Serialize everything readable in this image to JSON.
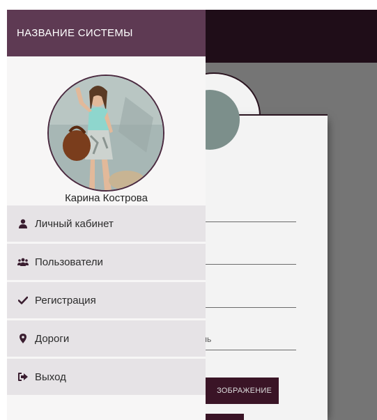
{
  "sidebar": {
    "system_title": "НАЗВАНИЕ СИСТЕМЫ",
    "user_name": "Карина Кострова",
    "items": [
      {
        "label": "Личный кабинет",
        "icon": "user-icon"
      },
      {
        "label": "Пользователи",
        "icon": "users-icon"
      },
      {
        "label": "Регистрация",
        "icon": "check-icon"
      },
      {
        "label": "Дороги",
        "icon": "map-marker-icon"
      },
      {
        "label": "Выход",
        "icon": "sign-out-icon"
      }
    ]
  },
  "background": {
    "upload_button_label": "ЗОБРАЖЕНИЕ",
    "field_hint_fragment": "ль"
  },
  "colors": {
    "header_bg": "#5e3a53",
    "topbar_bg": "#1f0d18",
    "drawer_bg": "#f7f6f6",
    "menu_item_bg": "#e6e3e6",
    "accent_dark": "#3a1426"
  }
}
